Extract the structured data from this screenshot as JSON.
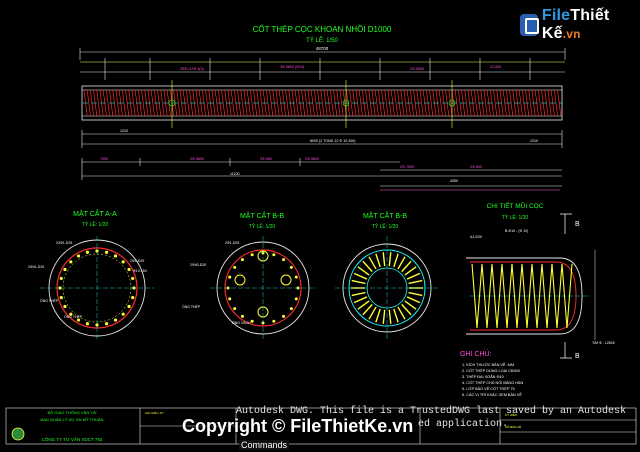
{
  "logo": {
    "part1": "File",
    "part2": "Thiết Kế",
    "part3": ".vn"
  },
  "drawing": {
    "main_title": "CỐT THÉP CỌC KHOAN NHỒI D1000",
    "main_scale": "TỶ LỆ: 1/50",
    "dim_top": "48700",
    "section_a": {
      "title": "MẶT CẮT A-A",
      "scale": "TỶ LỆ: 1/20"
    },
    "section_b": {
      "title": "MẶT CẮT B-B",
      "scale": "TỶ LỆ: 1/20"
    },
    "section_c": {
      "title": "MẶT CẮT B-B",
      "scale": "TỶ LỆ: 1/20"
    },
    "detail": {
      "title": "CHI TIẾT MŨI CỌC",
      "scale": "TỶ LỆ: 1/20",
      "marker": "B"
    },
    "notes_title": "GHI CHÚ:",
    "notes": [
      "1. KÍCH THƯỚC BẢN VẼ: MM",
      "2. CỐT THÉP DÙNG LOẠI CB300",
      "3. THÉP ĐAI XOẮN Φ10",
      "4. CỐT THÉP CHỦ NỐI BẰNG HÀN",
      "5. LỚP BẢO VỆ CỐT THÉP 75",
      "6. CÁC VỊ TRÍ KHÁC XEM BẢN VẼ"
    ],
    "title_block": {
      "org1": "BỘ GIAO THÔNG VẬN TẢI",
      "org2": "BAN QUẢN LÝ DỰ ÁN MỸ THUẬN",
      "org3": "CÔNG TY TƯ VẤN XDCT 793"
    }
  },
  "status_bar": {
    "line1": "Autodesk DWG.  This file is a TrustedDWG last saved by an Autodesk",
    "line2": "ed application.",
    "copyright": "Copyright © FileThietKe.vn",
    "commands": "Commands"
  }
}
